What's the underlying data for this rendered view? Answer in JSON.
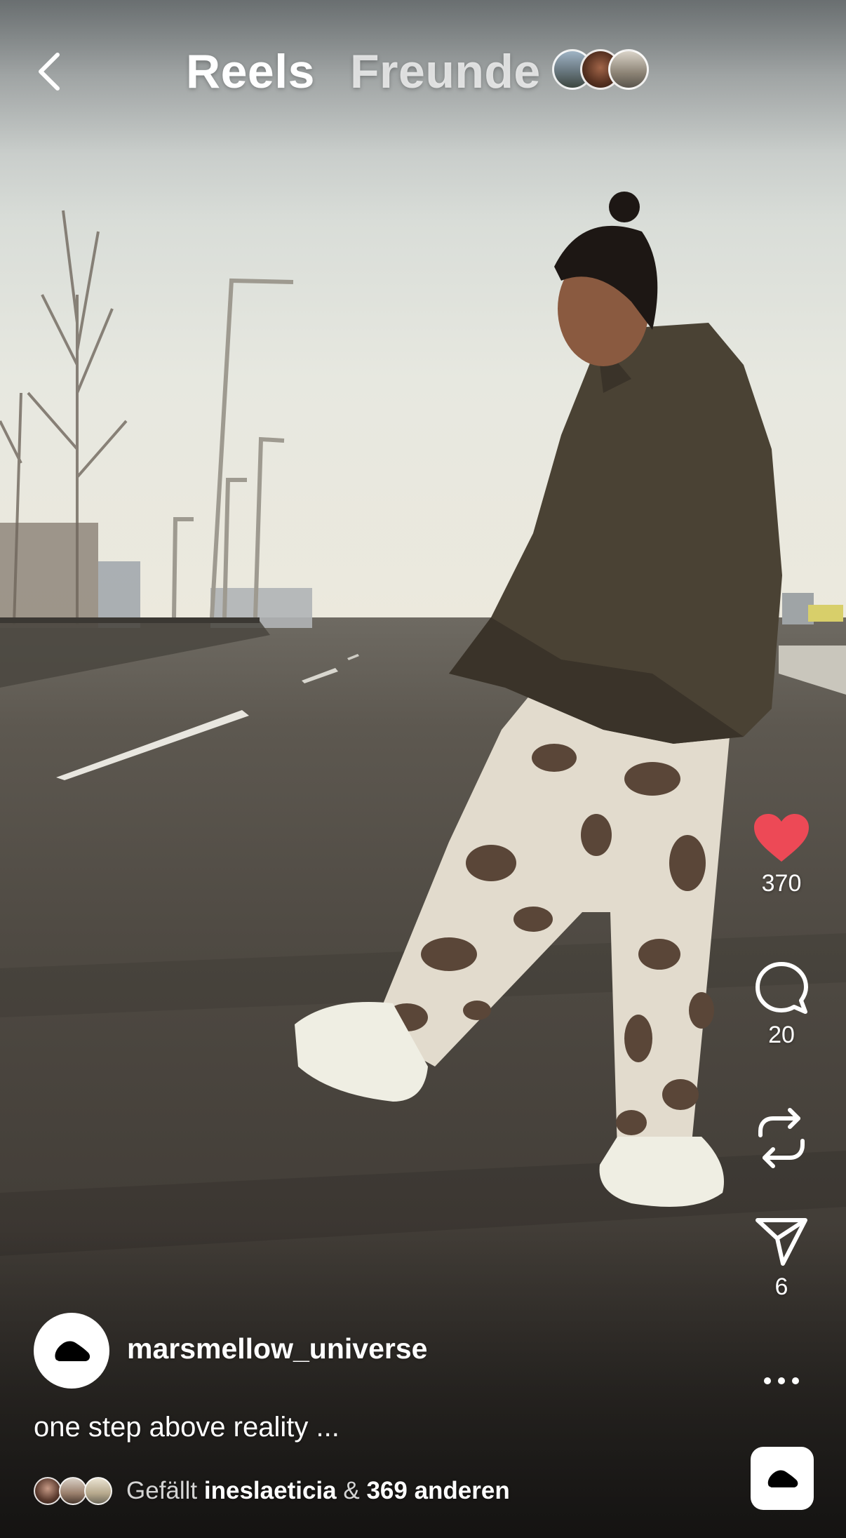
{
  "header": {
    "back_icon": "chevron-left-icon",
    "tabs": [
      {
        "label": "Reels",
        "active": true
      },
      {
        "label": "Freunde",
        "active": false
      }
    ],
    "friend_avatars_count": 3
  },
  "actions": {
    "like": {
      "icon": "heart-filled-icon",
      "count": "370",
      "color": "#ed4956",
      "liked": true
    },
    "comment": {
      "icon": "comment-icon",
      "count": "20"
    },
    "repost": {
      "icon": "repost-icon"
    },
    "share": {
      "icon": "paper-plane-icon",
      "count": "6"
    },
    "more": {
      "icon": "more-horizontal-icon"
    }
  },
  "post": {
    "username": "marsmellow_universe",
    "caption": "one step above reality ...",
    "likes": {
      "prefix": "Gefällt",
      "user": "ineslaeticia",
      "connector": "&",
      "others": "369 anderen"
    }
  },
  "audio": {
    "icon": "shoe-logo-icon"
  }
}
